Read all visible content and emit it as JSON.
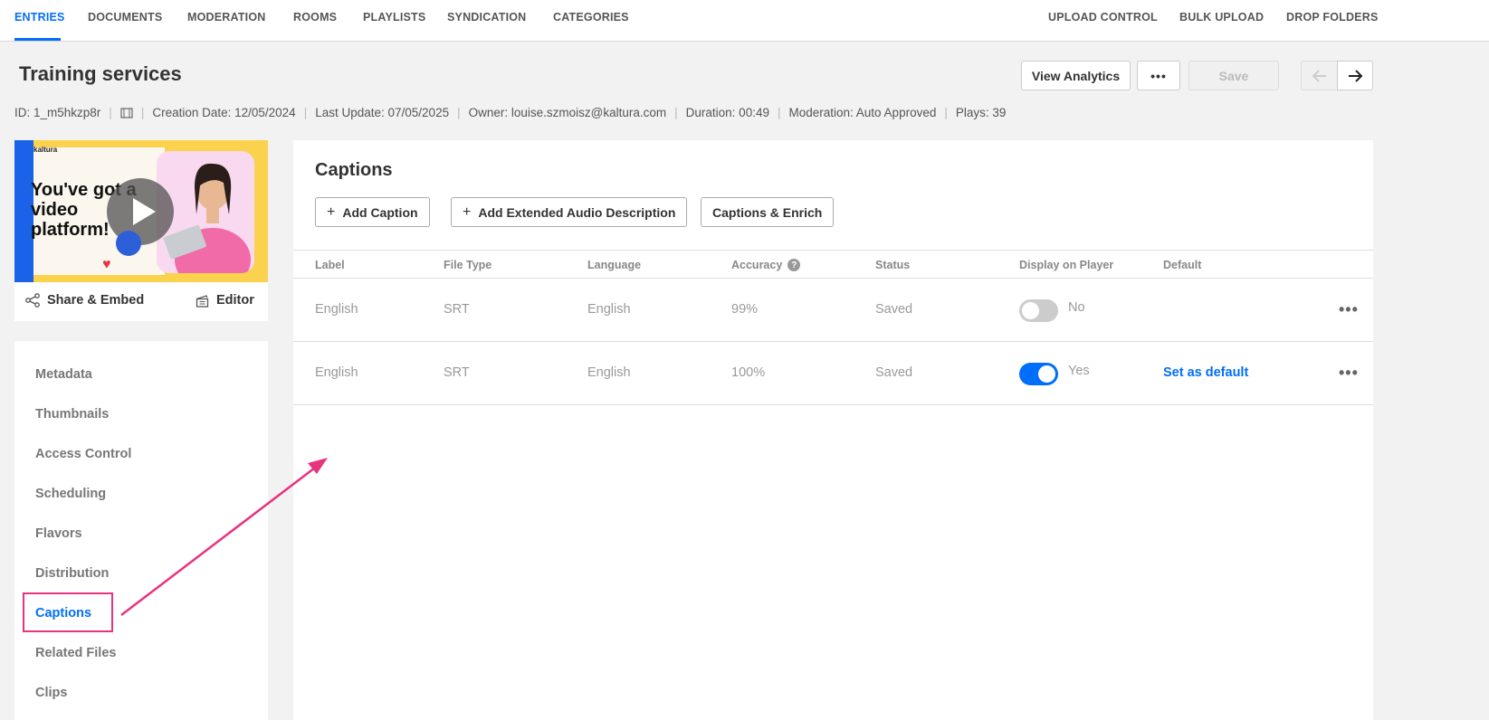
{
  "topnav": {
    "left": [
      "ENTRIES",
      "DOCUMENTS",
      "MODERATION",
      "ROOMS",
      "PLAYLISTS",
      "SYNDICATION",
      "CATEGORIES"
    ],
    "right": [
      "UPLOAD CONTROL",
      "BULK UPLOAD",
      "DROP FOLDERS"
    ]
  },
  "header": {
    "title": "Training services",
    "view_analytics": "View Analytics",
    "more": "•••",
    "save": "Save",
    "prev_icon": "arrow-left-icon",
    "next_icon": "arrow-right-icon"
  },
  "meta": {
    "id": "ID: 1_m5hkzp8r",
    "creation": "Creation Date: 12/05/2024",
    "update": "Last Update: 07/05/2025",
    "owner": "Owner: louise.szmoisz@kaltura.com",
    "duration": "Duration: 00:49",
    "moderation": "Moderation: Auto Approved",
    "plays": "Plays: 39"
  },
  "thumbnail": {
    "brand": "kaltura",
    "headline": "You've got a video platform!"
  },
  "card_actions": {
    "share": "Share & Embed",
    "editor": "Editor"
  },
  "sidebar": {
    "items": [
      "Metadata",
      "Thumbnails",
      "Access Control",
      "Scheduling",
      "Flavors",
      "Distribution",
      "Captions",
      "Related Files",
      "Clips"
    ]
  },
  "captions": {
    "title": "Captions",
    "add_caption": "Add Caption",
    "add_audio": "Add Extended Audio Description",
    "enrich": "Captions & Enrich",
    "columns": [
      "Label",
      "File Type",
      "Language",
      "Accuracy",
      "Status",
      "Display on Player",
      "Default"
    ],
    "rows": [
      {
        "label": "English",
        "file_type": "SRT",
        "language": "English",
        "accuracy": "99%",
        "status": "Saved",
        "display": "No",
        "display_on": false,
        "default": ""
      },
      {
        "label": "English",
        "file_type": "SRT",
        "language": "English",
        "accuracy": "100%",
        "status": "Saved",
        "display": "Yes",
        "display_on": true,
        "default": "Set as default"
      }
    ]
  },
  "colors": {
    "accent": "#006efa",
    "highlight": "#e8337f"
  }
}
